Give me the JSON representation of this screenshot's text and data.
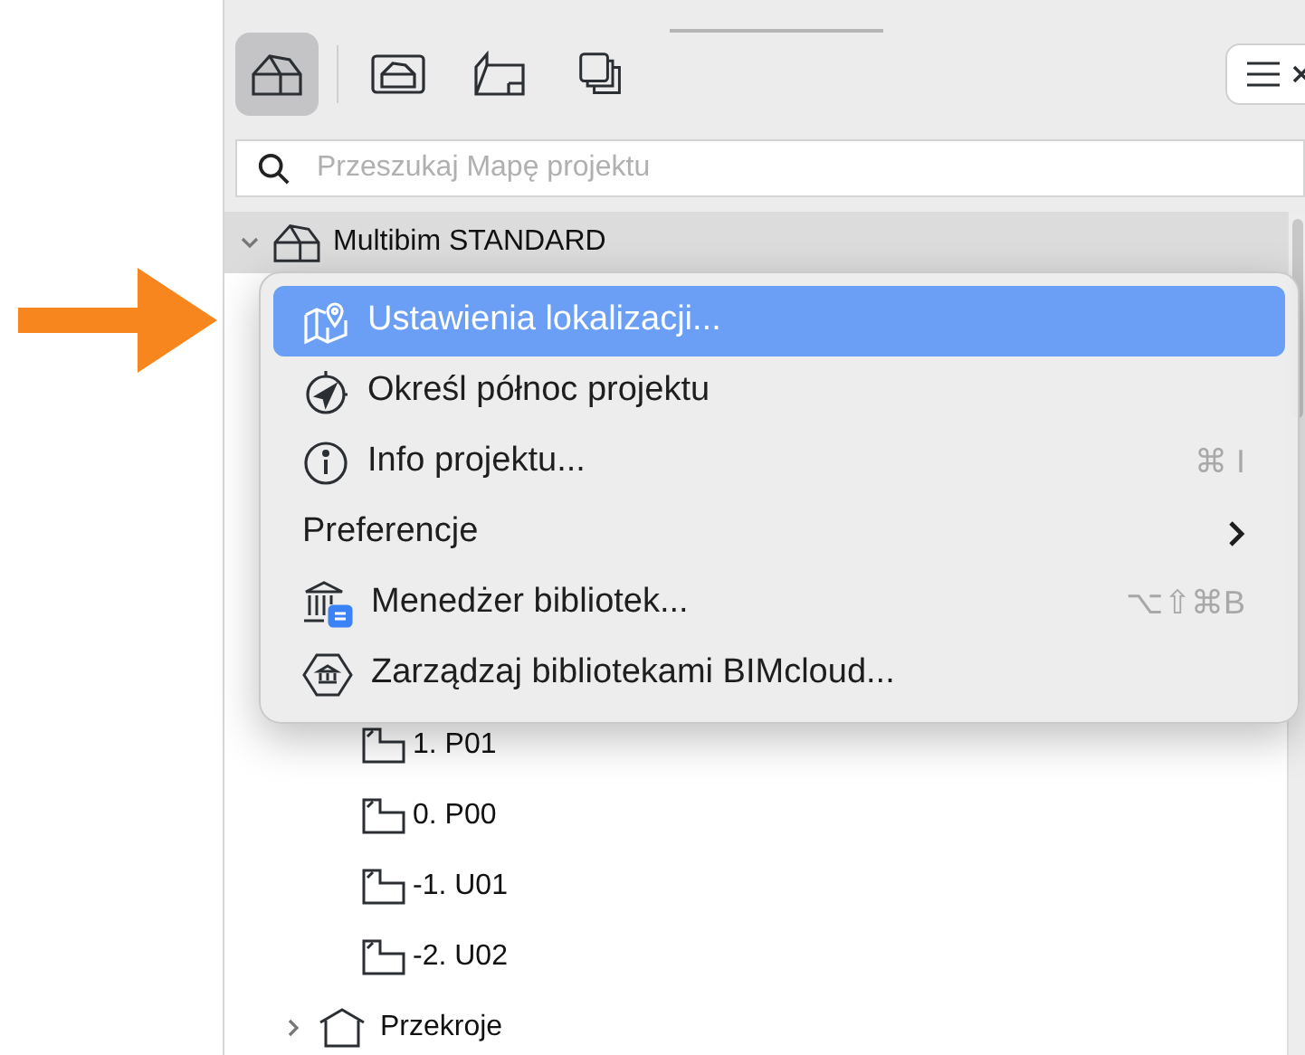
{
  "toolbar": {
    "buttons": [
      {
        "selected": true
      },
      {
        "selected": false
      },
      {
        "selected": false
      },
      {
        "selected": false
      }
    ]
  },
  "search": {
    "placeholder": "Przeszukaj Mapę projektu"
  },
  "tree": [
    {
      "label": "Multibim STANDARD",
      "expanded": true,
      "selected": true,
      "children": [
        {
          "label": "1. P01",
          "kind": "story"
        },
        {
          "label": "0. P00",
          "kind": "story"
        },
        {
          "label": "-1. U01",
          "kind": "story"
        },
        {
          "label": "-2. U02",
          "kind": "story"
        },
        {
          "label": "Przekroje",
          "kind": "folder",
          "expanded": false
        }
      ]
    }
  ],
  "context_menu": {
    "items": [
      {
        "label": "Ustawienia lokalizacji...",
        "selected": true,
        "kind": "item"
      },
      {
        "label": "Określ północ projektu",
        "selected": false,
        "kind": "item"
      },
      {
        "label": "Info projektu...",
        "selected": false,
        "kind": "item",
        "shortcut": "⌘ I"
      },
      {
        "label": "Preferencje",
        "selected": false,
        "kind": "submenu"
      },
      {
        "label": "Menedżer bibliotek...",
        "selected": false,
        "kind": "item",
        "shortcut": "⌥⇧⌘B"
      },
      {
        "label": "Zarządzaj bibliotekami BIMcloud...",
        "selected": false,
        "kind": "item"
      }
    ]
  }
}
